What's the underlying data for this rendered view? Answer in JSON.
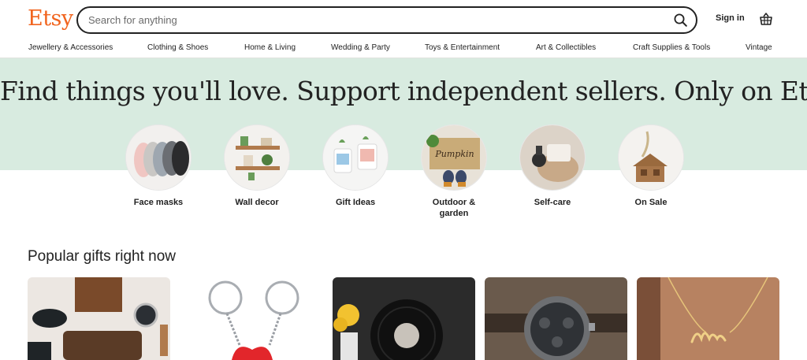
{
  "header": {
    "logo": "Etsy",
    "search_placeholder": "Search for anything",
    "search_icon": "search-icon",
    "sign_in": "Sign in",
    "basket_icon": "basket-icon"
  },
  "categories_nav": [
    "Jewellery & Accessories",
    "Clothing & Shoes",
    "Home & Living",
    "Wedding & Party",
    "Toys & Entertainment",
    "Art & Collectibles",
    "Craft Supplies & Tools",
    "Vintage"
  ],
  "hero": {
    "title": "Find things you'll love. Support independent sellers. Only on Etsy."
  },
  "featured": [
    {
      "label": "Face masks"
    },
    {
      "label": "Wall decor"
    },
    {
      "label": "Gift Ideas"
    },
    {
      "label": "Outdoor &\ngarden"
    },
    {
      "label": "Self-care"
    },
    {
      "label": "On Sale"
    }
  ],
  "popular": {
    "title": "Popular gifts right now"
  },
  "colors": {
    "brand": "#f1641e",
    "hero_band": "#d8ebe0"
  }
}
